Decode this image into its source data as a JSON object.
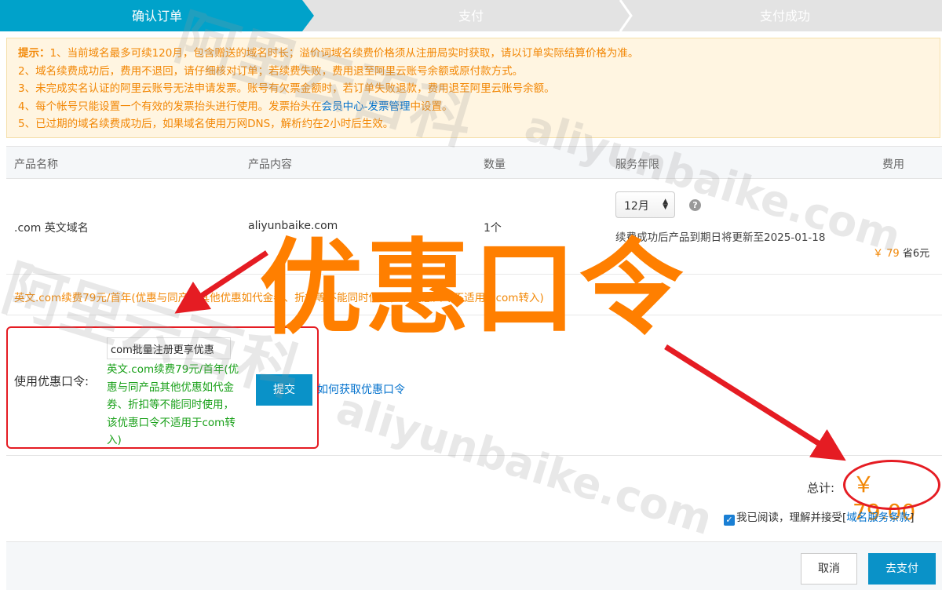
{
  "steps": [
    "确认订单",
    "支付",
    "支付成功"
  ],
  "notice": {
    "lead": "提示：",
    "line1": "1、当前域名最多可续120月，包含赠送的域名时长；溢价词域名续费价格须从注册局实时获取，请以订单实际结算价格为准。",
    "line2": "2、域名续费成功后，费用不退回，请仔细核对订单；若续费失败，费用退至阿里云账号余额或原付款方式。",
    "line3": "3、未完成实名认证的阿里云账号无法申请发票。账号有欠票金额时，若订单失败退款，费用退至阿里云账号余额。",
    "line4_pre": "4、每个帐号只能设置一个有效的发票抬头进行使用。发票抬头在",
    "line4_link": "会员中心-发票管理",
    "line4_post": "中设置。",
    "line5": "5、已过期的域名续费成功后，如果域名使用万网DNS，解析约在2小时后生效。"
  },
  "table": {
    "headers": [
      "产品名称",
      "产品内容",
      "数量",
      "服务年限",
      "费用"
    ],
    "row": {
      "product_name": ".com 英文域名",
      "product_content": "aliyunbaike.com",
      "quantity": "1个",
      "term": "12月",
      "help": "?",
      "renew_note": "续费成功后产品到期日将更新至2025-01-18",
      "price": "￥ 79",
      "save": "省6元"
    }
  },
  "promo_text": "英文.com续费79元/首年(优惠与同产品其他优惠如代金券、折扣等不能同时使用，该优惠口令不适用于com转入)",
  "coupon": {
    "label": "使用优惠口令:",
    "input_value": "com批量注册更享优惠",
    "desc": "英文.com续费79元/首年(优惠与同产品其他优惠如代金券、折扣等不能同时使用，该优惠口令不适用于com转入)",
    "submit": "提交",
    "how_link": "如何获取优惠口令"
  },
  "total": {
    "label": "总计:",
    "amount": "￥ 79.00"
  },
  "agree": {
    "check": "✓",
    "text": "我已阅读，理解并接受[",
    "terms": "域名服务条款",
    "close": "]"
  },
  "buttons": {
    "cancel": "取消",
    "pay": "去支付"
  },
  "annotation": {
    "big_text": "优惠口令",
    "watermark_cn": "阿里云百科",
    "watermark_en": "aliyunbaike.com"
  },
  "colors": {
    "accent": "#00a2ca",
    "orange": "#f28705",
    "annotation_red": "#e51c23",
    "annotation_orange": "#ff7f00",
    "green": "#19a019",
    "link": "#0070cc"
  }
}
